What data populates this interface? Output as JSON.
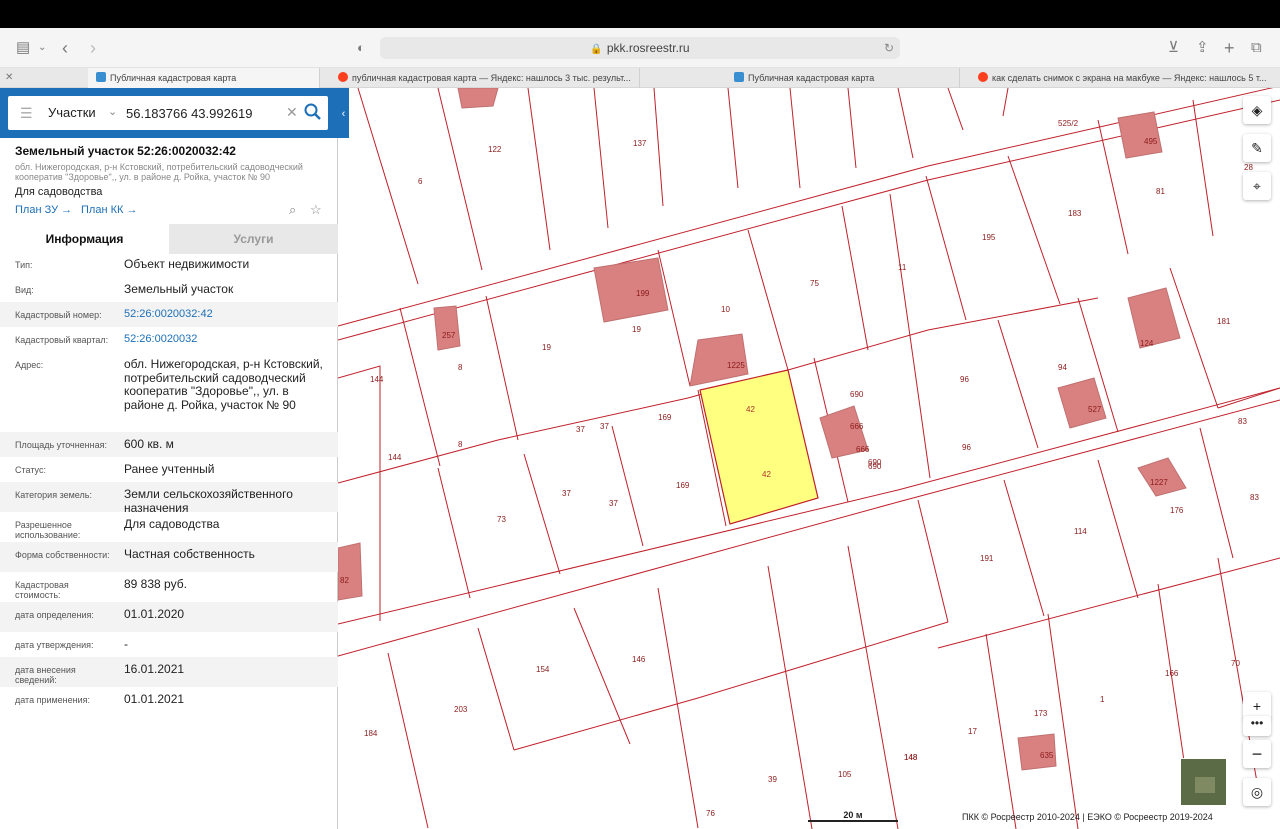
{
  "browser": {
    "url": "pkk.rosreestr.ru",
    "tabs": [
      {
        "label": "Публичная кадастровая карта",
        "favicon": "pkk-icon"
      },
      {
        "label": "публичная кадастровая карта — Яндекс: нашлось 3 тыс. результ...",
        "favicon": "yandex-icon"
      },
      {
        "label": "Публичная кадастровая карта",
        "favicon": "pkk-icon"
      },
      {
        "label": "как сделать снимок с экрана на макбуке — Яндекс: нашлось 5 т...",
        "favicon": "yandex-icon"
      }
    ]
  },
  "search": {
    "type": "Участки",
    "value": "56.183766 43.992619"
  },
  "object": {
    "title": "Земельный участок 52:26:0020032:42",
    "address_short": "обл. Нижегородская, р-н Кстовский, потребительский садоводческий кооператив \"Здоровье\",, ул. в районе д. Ройка, участок № 90",
    "use": "Для садоводства",
    "plan_zu": "План ЗУ",
    "plan_kk": "План КК"
  },
  "tabs": {
    "info": "Информация",
    "services": "Услуги"
  },
  "info_rows": [
    {
      "label": "Тип:",
      "value": "Объект недвижимости"
    },
    {
      "label": "Вид:",
      "value": "Земельный участок"
    },
    {
      "label": "Кадастровый номер:",
      "value": "52:26:0020032:42"
    },
    {
      "label": "Кадастровый квартал:",
      "value": "52:26:0020032"
    },
    {
      "label": "Адрес:",
      "value": "обл. Нижегородская, р-н Кстовский, потребительский садоводческий кооператив \"Здоровье\",, ул. в районе д. Ройка, участок № 90"
    },
    {
      "label": "Площадь уточненная:",
      "value": "600 кв. м"
    },
    {
      "label": "Статус:",
      "value": "Ранее учтенный"
    },
    {
      "label": "Категория земель:",
      "value": "Земли сельскохозяйственного назначения"
    },
    {
      "label": "Разрешенное использование:",
      "value": "Для садоводства"
    },
    {
      "label": "Форма собственности:",
      "value": "Частная собственность"
    },
    {
      "label": "Кадастровая стоимость:",
      "value": "89 838 руб."
    },
    {
      "label": "дата определения:",
      "value": "01.01.2020"
    },
    {
      "label": "дата утверждения:",
      "value": "-"
    },
    {
      "label": "дата внесения сведений:",
      "value": "16.01.2021"
    },
    {
      "label": "дата применения:",
      "value": "01.01.2021"
    }
  ],
  "map": {
    "scale_label": "20 м",
    "copyright": "ПКК © Росреестр 2010-2024 | ЕЭКО © Росреестр 2019-2024",
    "selected_label": "42",
    "parcel_color": "#c0202a",
    "building_color": "#d98080",
    "selected_fill": "#ffff80",
    "labels": [
      "122",
      "137",
      "6",
      "525/2",
      "28",
      "495",
      "81",
      "183",
      "195",
      "11",
      "75",
      "10",
      "199",
      "19",
      "19",
      "257",
      "8",
      "144",
      "1225",
      "690",
      "96",
      "94",
      "527",
      "124",
      "690",
      "181",
      "37",
      "37",
      "169",
      "666",
      "666",
      "690",
      "96",
      "83",
      "144",
      "8",
      "37",
      "37",
      "169",
      "1227",
      "176",
      "83",
      "73",
      "191",
      "114",
      "82",
      "148",
      "154",
      "146",
      "203",
      "184",
      "173",
      "1",
      "166",
      "70",
      "17",
      "635",
      "148",
      "105",
      "39",
      "76"
    ]
  }
}
